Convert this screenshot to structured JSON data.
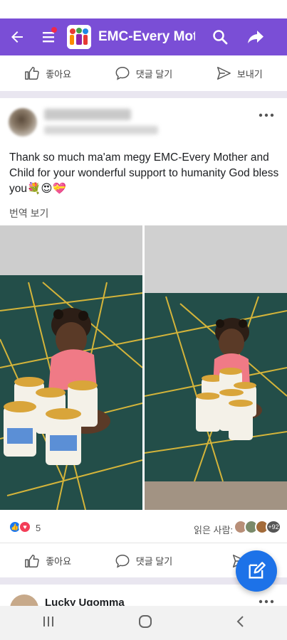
{
  "header": {
    "group_title": "EMC-Every Mot..."
  },
  "actions": {
    "like": "좋아요",
    "comment": "댓글 달기",
    "send": "보내기"
  },
  "post": {
    "text": "Thank so much ma'am megy EMC-Every Mother and Child for your wonderful support to humanity God bless you💐😍💝",
    "translate_label": "번역 보기",
    "reaction_count": "5",
    "seen_label": "읽은 사람:",
    "seen_more": "+92"
  },
  "next_post": {
    "author": "Lucky Ugomma"
  },
  "colors": {
    "app_bar": "#7a4ed6",
    "fab": "#1d72e8",
    "like_blue": "#1877f2",
    "love_red": "#f33e58"
  },
  "icons": [
    "back-arrow-icon",
    "menu-icon",
    "search-icon",
    "share-icon",
    "thumbs-up-icon",
    "comment-icon",
    "send-icon",
    "more-icon",
    "edit-icon",
    "recent-apps-icon",
    "home-icon",
    "nav-back-icon"
  ]
}
